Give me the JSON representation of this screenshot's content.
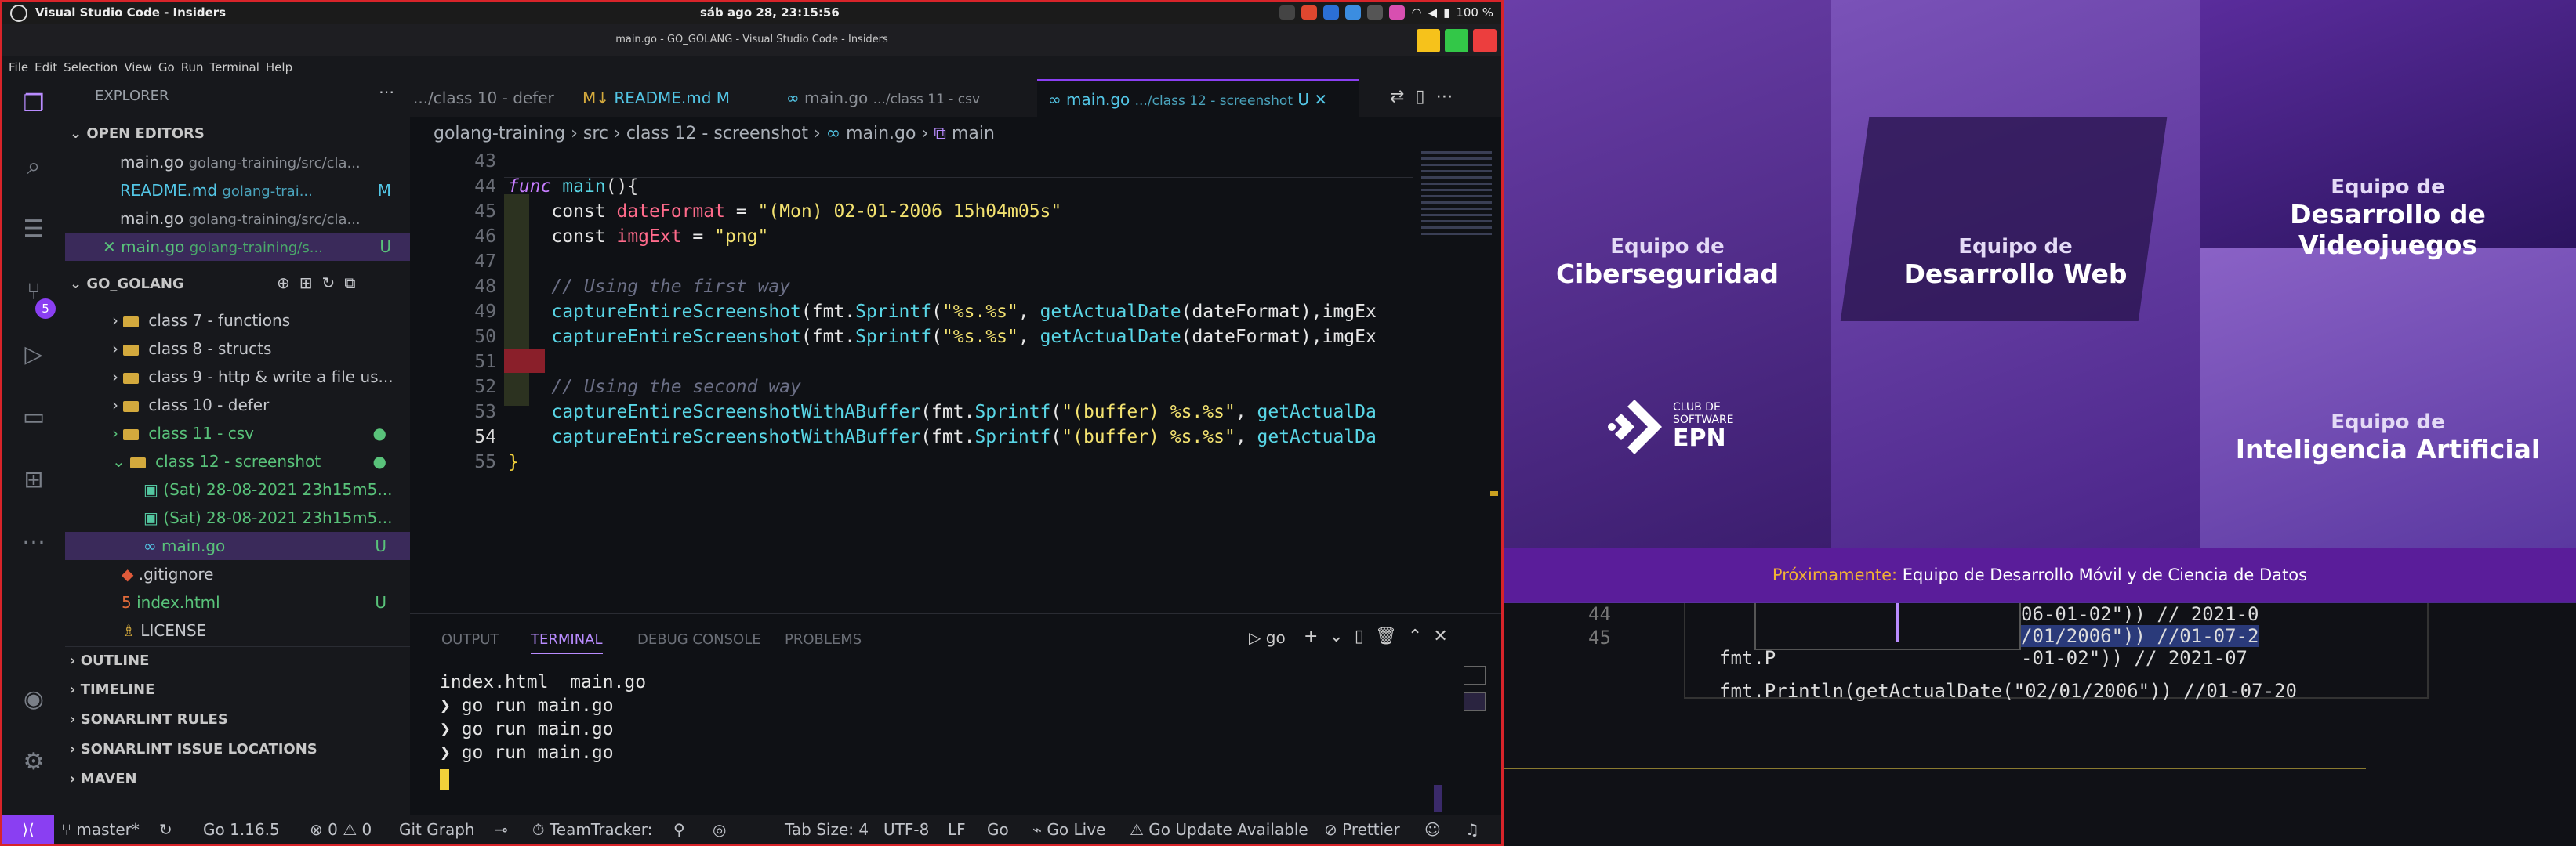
{
  "topbar": {
    "app": "Visual Studio Code - Insiders",
    "clock": "sáb ago 28, 23:15:56",
    "battery": "100 %"
  },
  "window": {
    "title": "main.go - GO_GOLANG - Visual Studio Code - Insiders"
  },
  "menu": [
    "File",
    "Edit",
    "Selection",
    "View",
    "Go",
    "Run",
    "Terminal",
    "Help"
  ],
  "activity": {
    "scm_badge": "5"
  },
  "sidebar": {
    "title": "EXPLORER",
    "open_editors": "OPEN EDITORS",
    "editors": [
      {
        "name": "main.go",
        "path": "golang-training/src/cla..."
      },
      {
        "name": "README.md",
        "path": "golang-trai...",
        "status": "M"
      },
      {
        "name": "main.go",
        "path": "golang-training/src/cla..."
      },
      {
        "name": "main.go",
        "path": "golang-training/s...",
        "status": "U"
      }
    ],
    "workspace": "GO_GOLANG",
    "tree": [
      "class 7 - functions",
      "class 8 - structs",
      "class 9 - http & write a file us...",
      "class 10 - defer",
      "class 11 - csv",
      "class 12 - screenshot"
    ],
    "files": [
      "(Sat) 28-08-2021 23h15m5...",
      "(Sat) 28-08-2021 23h15m5...",
      "main.go"
    ],
    "root_files": [
      ".gitignore",
      "index.html",
      "LICENSE"
    ],
    "status_u": "U",
    "sections": [
      "OUTLINE",
      "TIMELINE",
      "SONARLINT RULES",
      "SONARLINT ISSUE LOCATIONS",
      "MAVEN"
    ]
  },
  "tabs": [
    {
      "label": ".../class 10 - defer"
    },
    {
      "label": "README.md",
      "status": "M"
    },
    {
      "label": "main.go",
      "desc": ".../class 11 - csv"
    },
    {
      "label": "main.go",
      "desc": ".../class 12 - screenshot",
      "status": "U"
    }
  ],
  "breadcrumbs": [
    "golang-training",
    "src",
    "class 12 - screenshot",
    "main.go",
    "main"
  ],
  "code": {
    "lines": [
      "43",
      "44",
      "45",
      "46",
      "47",
      "48",
      "49",
      "50",
      "51",
      "52",
      "53",
      "54",
      "55"
    ],
    "l44": [
      "func",
      " ",
      "main",
      "(){"
    ],
    "l45": [
      "    const ",
      "dateFormat",
      " = ",
      "\"(Mon) 02-01-2006 15h04m05s\""
    ],
    "l46": [
      "    const ",
      "imgExt",
      " = ",
      "\"png\""
    ],
    "l48": "    // Using the first way",
    "l49": [
      "    ",
      "captureEntireScreenshot",
      "(fmt.",
      "Sprintf",
      "(",
      "\"%s.%s\"",
      ", ",
      "getActualDate",
      "(dateFormat),imgEx"
    ],
    "l50": [
      "    ",
      "captureEntireScreenshot",
      "(fmt.",
      "Sprintf",
      "(",
      "\"%s.%s\"",
      ", ",
      "getActualDate",
      "(dateFormat),imgEx"
    ],
    "l52": "    // Using the second way",
    "l53": [
      "    ",
      "captureEntireScreenshotWithABuffer",
      "(fmt.",
      "Sprintf",
      "(",
      "\"(buffer) %s.%s\"",
      ", ",
      "getActualDa"
    ],
    "l54": [
      "    ",
      "captureEntireScreenshotWithABuffer",
      "(fmt.",
      "Sprintf",
      "(",
      "\"(buffer) %s.%s\"",
      ", ",
      "getActualDa"
    ],
    "l55": "}"
  },
  "panel": {
    "tabs": [
      "OUTPUT",
      "TERMINAL",
      "DEBUG CONSOLE",
      "PROBLEMS"
    ],
    "shell": "go",
    "terminal": [
      "index.html  main.go",
      "❯ go run main.go",
      "❯ go run main.go",
      "❯ go run main.go"
    ]
  },
  "status": {
    "branch": "master*",
    "go": "Go 1.16.5",
    "problems": "⊗ 0 ⚠ 0",
    "graph": "Git Graph",
    "team": "TeamTracker:",
    "tab": "Tab Size: 4",
    "enc": "UTF-8",
    "eol": "LF",
    "lang": "Go",
    "live": "Go Live",
    "update": "Go Update Available",
    "prettier": "Prettier"
  },
  "banner": {
    "teams": [
      {
        "small": "Equipo de",
        "large": "Ciberseguridad"
      },
      {
        "small": "Equipo de",
        "large": "Desarrollo Web"
      },
      {
        "small": "Equipo de",
        "large": "Desarrollo de Videojuegos"
      },
      {
        "small": "Equipo de",
        "large": "Inteligencia Artificial"
      }
    ],
    "logo_small": "CLUB DE",
    "logo_small2": "SOFTWARE",
    "logo_large": "EPN",
    "prox_label": "Próximamente:",
    "prox_text": " Equipo de Desarrollo Móvil y de Ciencia de Datos"
  },
  "bgcode": {
    "l44": "44",
    "l45": "45",
    "fmt1": "fmt.P",
    "fmt2": "fmt.Println(getActualDate(\"02/01/2006\")) //01-07-20",
    "c1": "06-01-02\")) // 2021-0",
    "c2": "/01/2006\")) //01-07-2",
    "c3": "-01-02\")) // 2021-07"
  }
}
